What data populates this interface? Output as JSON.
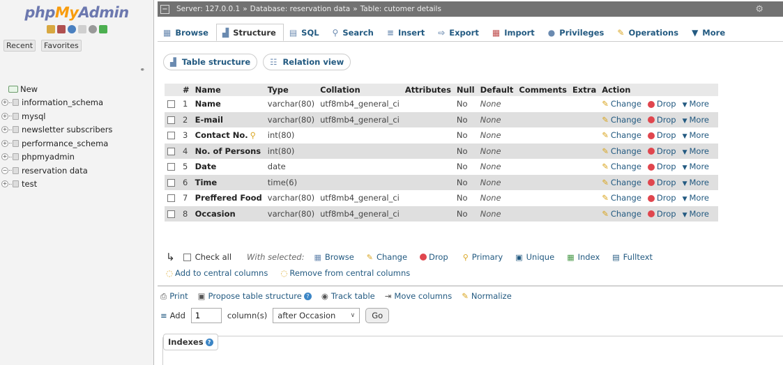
{
  "app": {
    "logo_php": "php",
    "logo_my": "My",
    "logo_admin": "Admin"
  },
  "nav": {
    "recent": "Recent",
    "favorites": "Favorites",
    "new_label": "New",
    "databases": [
      "information_schema",
      "mysql",
      "newsletter subscribers",
      "performance_schema",
      "phpmyadmin",
      "reservation data",
      "test"
    ]
  },
  "breadcrumb": {
    "server": "Server: 127.0.0.1",
    "database": "Database: reservation data",
    "table": "Table: cutomer details"
  },
  "tabs": [
    {
      "label": "Browse",
      "icon": "browse-icon"
    },
    {
      "label": "Structure",
      "icon": "structure-icon"
    },
    {
      "label": "SQL",
      "icon": "sql-icon"
    },
    {
      "label": "Search",
      "icon": "search-icon"
    },
    {
      "label": "Insert",
      "icon": "insert-icon"
    },
    {
      "label": "Export",
      "icon": "export-icon"
    },
    {
      "label": "Import",
      "icon": "import-icon"
    },
    {
      "label": "Privileges",
      "icon": "privileges-icon"
    },
    {
      "label": "Operations",
      "icon": "operations-icon"
    },
    {
      "label": "More",
      "icon": "chevron-down-icon"
    }
  ],
  "subtabs": {
    "table_structure": "Table structure",
    "relation_view": "Relation view"
  },
  "table": {
    "headers": [
      "#",
      "Name",
      "Type",
      "Collation",
      "Attributes",
      "Null",
      "Default",
      "Comments",
      "Extra",
      "Action"
    ],
    "rows": [
      {
        "num": "1",
        "name": "Name",
        "type": "varchar(80)",
        "collation": "utf8mb4_general_ci",
        "null": "No",
        "default": "None"
      },
      {
        "num": "2",
        "name": "E-mail",
        "type": "varchar(80)",
        "collation": "utf8mb4_general_ci",
        "null": "No",
        "default": "None"
      },
      {
        "num": "3",
        "name": "Contact No.",
        "type": "int(80)",
        "collation": "",
        "null": "No",
        "default": "None"
      },
      {
        "num": "4",
        "name": "No. of Persons",
        "type": "int(80)",
        "collation": "",
        "null": "No",
        "default": "None"
      },
      {
        "num": "5",
        "name": "Date",
        "type": "date",
        "collation": "",
        "null": "No",
        "default": "None"
      },
      {
        "num": "6",
        "name": "Time",
        "type": "time(6)",
        "collation": "",
        "null": "No",
        "default": "None"
      },
      {
        "num": "7",
        "name": "Preffered Food",
        "type": "varchar(80)",
        "collation": "utf8mb4_general_ci",
        "null": "No",
        "default": "None"
      },
      {
        "num": "8",
        "name": "Occasion",
        "type": "varchar(80)",
        "collation": "utf8mb4_general_ci",
        "null": "No",
        "default": "None"
      }
    ],
    "actions": {
      "change": "Change",
      "drop": "Drop",
      "more": "More"
    }
  },
  "bulk": {
    "check_all": "Check all",
    "with_selected": "With selected:",
    "browse": "Browse",
    "change": "Change",
    "drop": "Drop",
    "primary": "Primary",
    "unique": "Unique",
    "index": "Index",
    "fulltext": "Fulltext",
    "add_central": "Add to central columns",
    "remove_central": "Remove from central columns"
  },
  "links": {
    "print": "Print",
    "propose": "Propose table structure",
    "track": "Track table",
    "move": "Move columns",
    "normalize": "Normalize"
  },
  "addrow": {
    "add": "Add",
    "count": "1",
    "columns": "column(s)",
    "position": "after Occasion",
    "go": "Go"
  },
  "indexes": {
    "label": "Indexes"
  }
}
